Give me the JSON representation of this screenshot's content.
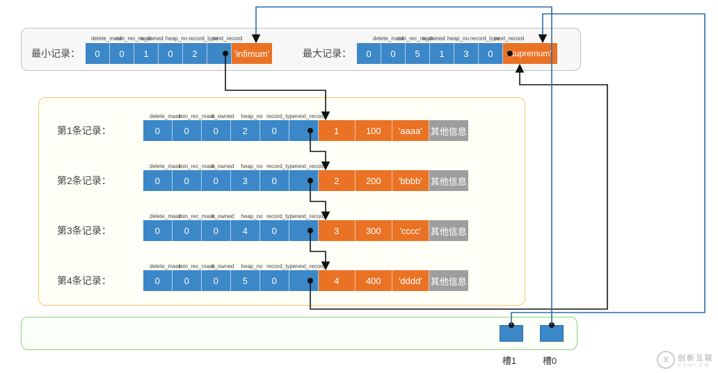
{
  "colors": {
    "blue": "#3c87c7",
    "orange": "#ea7225",
    "grey": "#9e9e9e"
  },
  "header_labels": [
    "delete_mask",
    "min_rec_mask",
    "n_owned",
    "heap_no",
    "record_type",
    "next_record"
  ],
  "top": {
    "min": {
      "title": "最小记录：",
      "fields": [
        "0",
        "0",
        "1",
        "0",
        "2",
        ""
      ],
      "tag": "'infimum'"
    },
    "max": {
      "title": "最大记录：",
      "fields": [
        "0",
        "0",
        "5",
        "1",
        "3",
        "0"
      ],
      "tag": "'supremum'"
    }
  },
  "records": [
    {
      "title": "第1条记录：",
      "fields": [
        "0",
        "0",
        "0",
        "2",
        "0",
        ""
      ],
      "cols": [
        "1",
        "100",
        "'aaaa'"
      ],
      "extra": "其他信息"
    },
    {
      "title": "第2条记录：",
      "fields": [
        "0",
        "0",
        "0",
        "3",
        "0",
        ""
      ],
      "cols": [
        "2",
        "200",
        "'bbbb'"
      ],
      "extra": "其他信息"
    },
    {
      "title": "第3条记录：",
      "fields": [
        "0",
        "0",
        "0",
        "4",
        "0",
        ""
      ],
      "cols": [
        "3",
        "300",
        "'cccc'"
      ],
      "extra": "其他信息"
    },
    {
      "title": "第4条记录：",
      "fields": [
        "0",
        "0",
        "0",
        "5",
        "0",
        ""
      ],
      "cols": [
        "4",
        "400",
        "'dddd'"
      ],
      "extra": "其他信息"
    }
  ],
  "slots": {
    "s1": "槽1",
    "s0": "槽0"
  },
  "watermark": {
    "mark": "X",
    "text1": "创新互联",
    "text2": "CXHLCN"
  }
}
